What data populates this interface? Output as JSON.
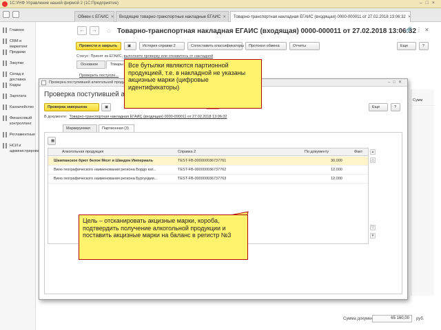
{
  "app": {
    "title": "1С:УНФ Управление нашей фирмой 2 (1С:Предприятие)",
    "tabs": [
      {
        "label": "Обмен с ЕГАИС"
      },
      {
        "label": "Входящие товарно-транспортные накладные ЕГАИС"
      },
      {
        "label": "Товарно-транспортная накладная ЕГАИС (входящая) 0000-000011 от 27.02.2018 13:06:32"
      }
    ]
  },
  "sidebar": {
    "items": [
      {
        "label": "Главное"
      },
      {
        "label": "CRM и маркетинг"
      },
      {
        "label": "Продажи"
      },
      {
        "label": "Закупки"
      },
      {
        "label": "Склад и доставка"
      },
      {
        "label": "Кадры"
      },
      {
        "label": "Зарплата"
      },
      {
        "label": "Казначейство"
      },
      {
        "label": "Финансовый контроллинг"
      },
      {
        "label": "Регламентные"
      },
      {
        "label": "НСИ и администрирование"
      }
    ]
  },
  "document": {
    "title": "Товарно-транспортная накладная ЕГАИС (входящая) 0000-000011 от 27.02.2018 13:06:32",
    "toolbar": {
      "post_close": "Провести и закрыть",
      "history": "История справки 2",
      "match": "Сопоставить классификаторы",
      "protocol": "Протокол обмена",
      "reports": "Отчеты",
      "more": "Еще",
      "help": "?"
    },
    "status": "Статус: Принят из ЕГАИС,",
    "status_link": "выполните проверку или откажитесь от накладной",
    "tabs": [
      {
        "label": "Основное"
      },
      {
        "label": "Товары (3)"
      }
    ],
    "check_link": "Проверить поступле...",
    "sum_label": "Сумма документа:",
    "sum_value": "65 160,00",
    "sum_currency": "руб.",
    "right_rows": [
      "Сумм",
      "",
      "",
      ""
    ]
  },
  "modal": {
    "window_title": "Проверка поступившей алкогольной продукции",
    "heading": "Проверка поступившей алкогольной продукции",
    "finish_button": "Проверка завершена",
    "more": "Еще",
    "help": "?",
    "doc_label": "В документе:",
    "doc_link": "Товарно-транспортная накладная ЕГАИС (входящая) 0000-000011 от 27.02.2018 13:06:32",
    "tabs": [
      {
        "label": "Маркируемая"
      },
      {
        "label": "Партионная (3)"
      }
    ],
    "columns": {
      "product": "Алкогольная продукция",
      "ref": "Справка 2",
      "doc": "По документу",
      "fact": "Факт"
    },
    "rows": [
      {
        "product": "Шампанское брют белое Моэт и Шандон Империаль",
        "ref": "TEST-FB-000000036737761",
        "doc": "30,000",
        "fact": ""
      },
      {
        "product": "Вино географического наименования региона Бордо кат...",
        "ref": "TEST-FB-000000036737762",
        "doc": "12,000",
        "fact": ""
      },
      {
        "product": "Вино географического наименования региона Бургундии...",
        "ref": "TEST-FB-000000036737763",
        "doc": "12,000",
        "fact": ""
      }
    ]
  },
  "callouts": {
    "top": "Все бутылки являются партионной продукцией, т.е. в накладной не указаны акцизные марки (цифровые идентификаторы)",
    "bottom": "Цель – отсканировать акцизные марки, короба, подтвердить получение алкогольной продукции и поставить акцизные марки на баланс в регистр №3"
  },
  "colors": {
    "callout_fill": "#fff36e",
    "callout_border": "#b30000",
    "primary_button": "#f7d836",
    "selected_row": "#fff5c8"
  }
}
